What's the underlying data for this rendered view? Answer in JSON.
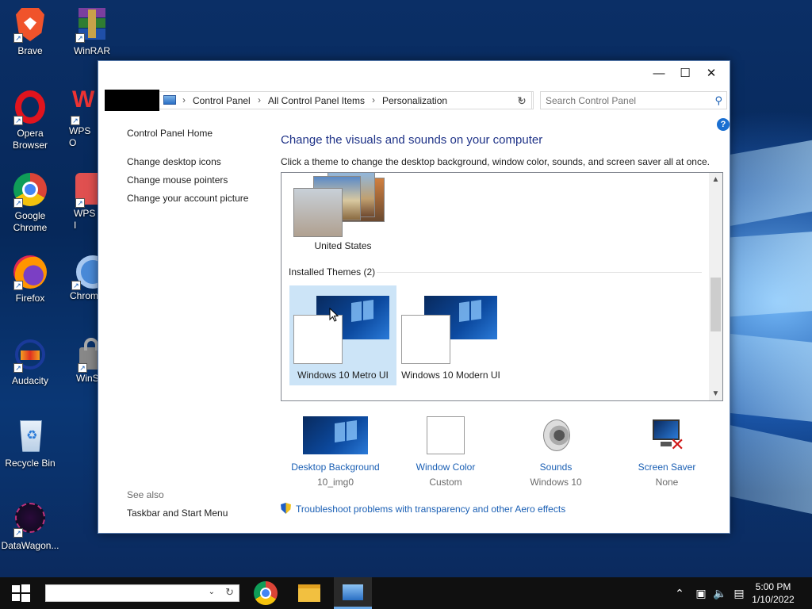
{
  "desktop": {
    "icons": [
      {
        "label": "Brave",
        "icon": "brave-icon"
      },
      {
        "label": "WinRAR",
        "icon": "winrar-icon"
      },
      {
        "label": "Opera Browser",
        "icon": "opera-icon"
      },
      {
        "label": "WPS O",
        "icon": "wps-office-icon"
      },
      {
        "label": "Google Chrome",
        "icon": "chrome-icon"
      },
      {
        "label": "WPS I",
        "icon": "wps-icon"
      },
      {
        "label": "Firefox",
        "icon": "firefox-icon"
      },
      {
        "label": "Chrom",
        "icon": "chromium-icon"
      },
      {
        "label": "Audacity",
        "icon": "audacity-icon"
      },
      {
        "label": "WinS",
        "icon": "winscp-icon"
      },
      {
        "label": "Recycle Bin",
        "icon": "recycle-bin-icon"
      },
      {
        "label": "DataWagon...",
        "icon": "datawagon-icon"
      }
    ]
  },
  "window": {
    "controls": {
      "minimize": "—",
      "maximize": "☐",
      "close": "✕"
    },
    "address": {
      "crumbs": [
        "Control Panel",
        "All Control Panel Items",
        "Personalization"
      ],
      "separator": "›"
    },
    "search": {
      "placeholder": "Search Control Panel"
    },
    "help": "?",
    "leftnav": {
      "home": "Control Panel Home",
      "links": [
        "Change desktop icons",
        "Change mouse pointers",
        "Change your account picture"
      ],
      "see_also": "See also",
      "taskbar_link": "Taskbar and Start Menu"
    },
    "main": {
      "heading": "Change the visuals and sounds on your computer",
      "subtext": "Click a theme to change the desktop background, window color, sounds, and screen saver all at once.",
      "themes": {
        "top_theme": "United States",
        "group_label": "Installed Themes (2)",
        "installed": [
          "Windows 10 Metro UI",
          "Windows 10 Modern UI"
        ],
        "selected_index": 0
      },
      "bottom": [
        {
          "label": "Desktop Background",
          "value": "10_img0"
        },
        {
          "label": "Window Color",
          "value": "Custom"
        },
        {
          "label": "Sounds",
          "value": "Windows 10"
        },
        {
          "label": "Screen Saver",
          "value": "None"
        }
      ],
      "troubleshoot": "Troubleshoot problems with transparency and other Aero effects"
    }
  },
  "taskbar": {
    "search_value": "",
    "apps": [
      "chrome-icon",
      "file-explorer-icon",
      "control-panel-icon"
    ],
    "active_app_index": 2,
    "clock": {
      "time": "5:00 PM",
      "date": "1/10/2022"
    },
    "tray": [
      "chevron-up-icon",
      "network-icon",
      "volume-icon",
      "action-center-icon"
    ]
  },
  "colors": {
    "accent": "#1a5fb4",
    "heading": "#1e3287",
    "selection": "#cce4f7",
    "taskbar": "#101010"
  }
}
